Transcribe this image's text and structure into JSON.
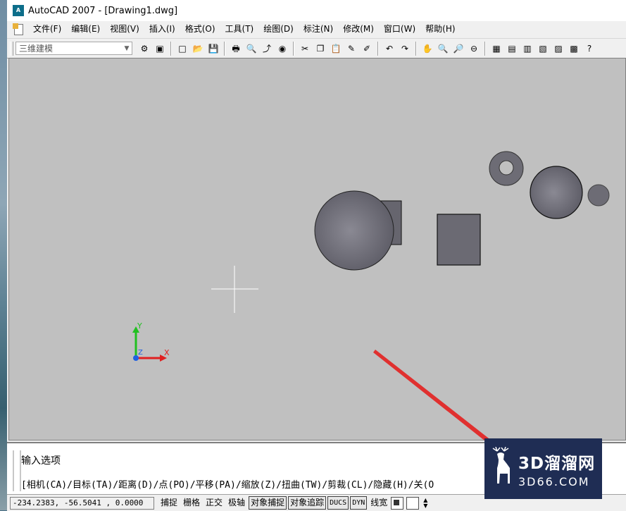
{
  "window": {
    "title": "AutoCAD 2007 - [Drawing1.dwg]",
    "app_icon_label": "A"
  },
  "menu": [
    {
      "label": "文件(F)"
    },
    {
      "label": "编辑(E)"
    },
    {
      "label": "视图(V)"
    },
    {
      "label": "插入(I)"
    },
    {
      "label": "格式(O)"
    },
    {
      "label": "工具(T)"
    },
    {
      "label": "绘图(D)"
    },
    {
      "label": "标注(N)"
    },
    {
      "label": "修改(M)"
    },
    {
      "label": "窗口(W)"
    },
    {
      "label": "帮助(H)"
    }
  ],
  "toolbar": {
    "workspace_value": "三维建模",
    "buttons": [
      {
        "name": "workspace-settings-icon",
        "glyph": "⚙"
      },
      {
        "name": "workspace-save-icon",
        "glyph": "▣"
      },
      {
        "name": "new-file-icon",
        "glyph": "□"
      },
      {
        "name": "open-file-icon",
        "glyph": "📂"
      },
      {
        "name": "save-icon",
        "glyph": "💾"
      },
      {
        "name": "plot-icon",
        "glyph": "🖶"
      },
      {
        "name": "plot-preview-icon",
        "glyph": "🔍"
      },
      {
        "name": "publish-icon",
        "glyph": "⤴"
      },
      {
        "name": "3d-dwf-icon",
        "glyph": "◉"
      },
      {
        "name": "cut-icon",
        "glyph": "✂"
      },
      {
        "name": "copy-icon",
        "glyph": "❐"
      },
      {
        "name": "paste-icon",
        "glyph": "📋"
      },
      {
        "name": "match-properties-icon",
        "glyph": "✎"
      },
      {
        "name": "block-editor-icon",
        "glyph": "✐"
      },
      {
        "name": "undo-icon",
        "glyph": "↶"
      },
      {
        "name": "redo-icon",
        "glyph": "↷"
      },
      {
        "name": "pan-icon",
        "glyph": "✋"
      },
      {
        "name": "zoom-realtime-icon",
        "glyph": "🔍"
      },
      {
        "name": "zoom-window-icon",
        "glyph": "🔎"
      },
      {
        "name": "zoom-previous-icon",
        "glyph": "⊖"
      },
      {
        "name": "properties-icon",
        "glyph": "▦"
      },
      {
        "name": "design-center-icon",
        "glyph": "▤"
      },
      {
        "name": "tool-palettes-icon",
        "glyph": "▥"
      },
      {
        "name": "sheet-set-manager-icon",
        "glyph": "▧"
      },
      {
        "name": "markup-set-manager-icon",
        "glyph": "▨"
      },
      {
        "name": "quickcalc-icon",
        "glyph": "▩"
      },
      {
        "name": "help-icon",
        "glyph": "?"
      }
    ]
  },
  "command": {
    "line1": "输入选项",
    "line2": "[相机(CA)/目标(TA)/距离(D)/点(PO)/平移(PA)/缩放(Z)/扭曲(TW)/剪裁(CL)/隐藏(H)/关(O"
  },
  "status": {
    "coords": "-234.2383, -56.5041 , 0.0000",
    "buttons": [
      {
        "label": "捕捉",
        "on": false,
        "mono": false
      },
      {
        "label": "栅格",
        "on": false,
        "mono": false
      },
      {
        "label": "正交",
        "on": false,
        "mono": false
      },
      {
        "label": "极轴",
        "on": false,
        "mono": false
      },
      {
        "label": "对象捕捉",
        "on": true,
        "mono": false
      },
      {
        "label": "对象追踪",
        "on": true,
        "mono": false
      },
      {
        "label": "DUCS",
        "on": true,
        "mono": true
      },
      {
        "label": "DYN",
        "on": true,
        "mono": true
      },
      {
        "label": "线宽",
        "on": false,
        "mono": false
      }
    ]
  },
  "ucs": {
    "x_label": "X",
    "y_label": "Y",
    "z_label": "Z"
  },
  "watermark": {
    "line1": "3D溜溜网",
    "line2": "3D66.COM"
  },
  "colors": {
    "viewport_bg": "#c0c0c0",
    "solid_gray": "#6b6a73",
    "annotation_red": "#e0302f",
    "ucs_x": "#e02020",
    "ucs_y": "#20c020",
    "ucs_z": "#2060e0"
  }
}
